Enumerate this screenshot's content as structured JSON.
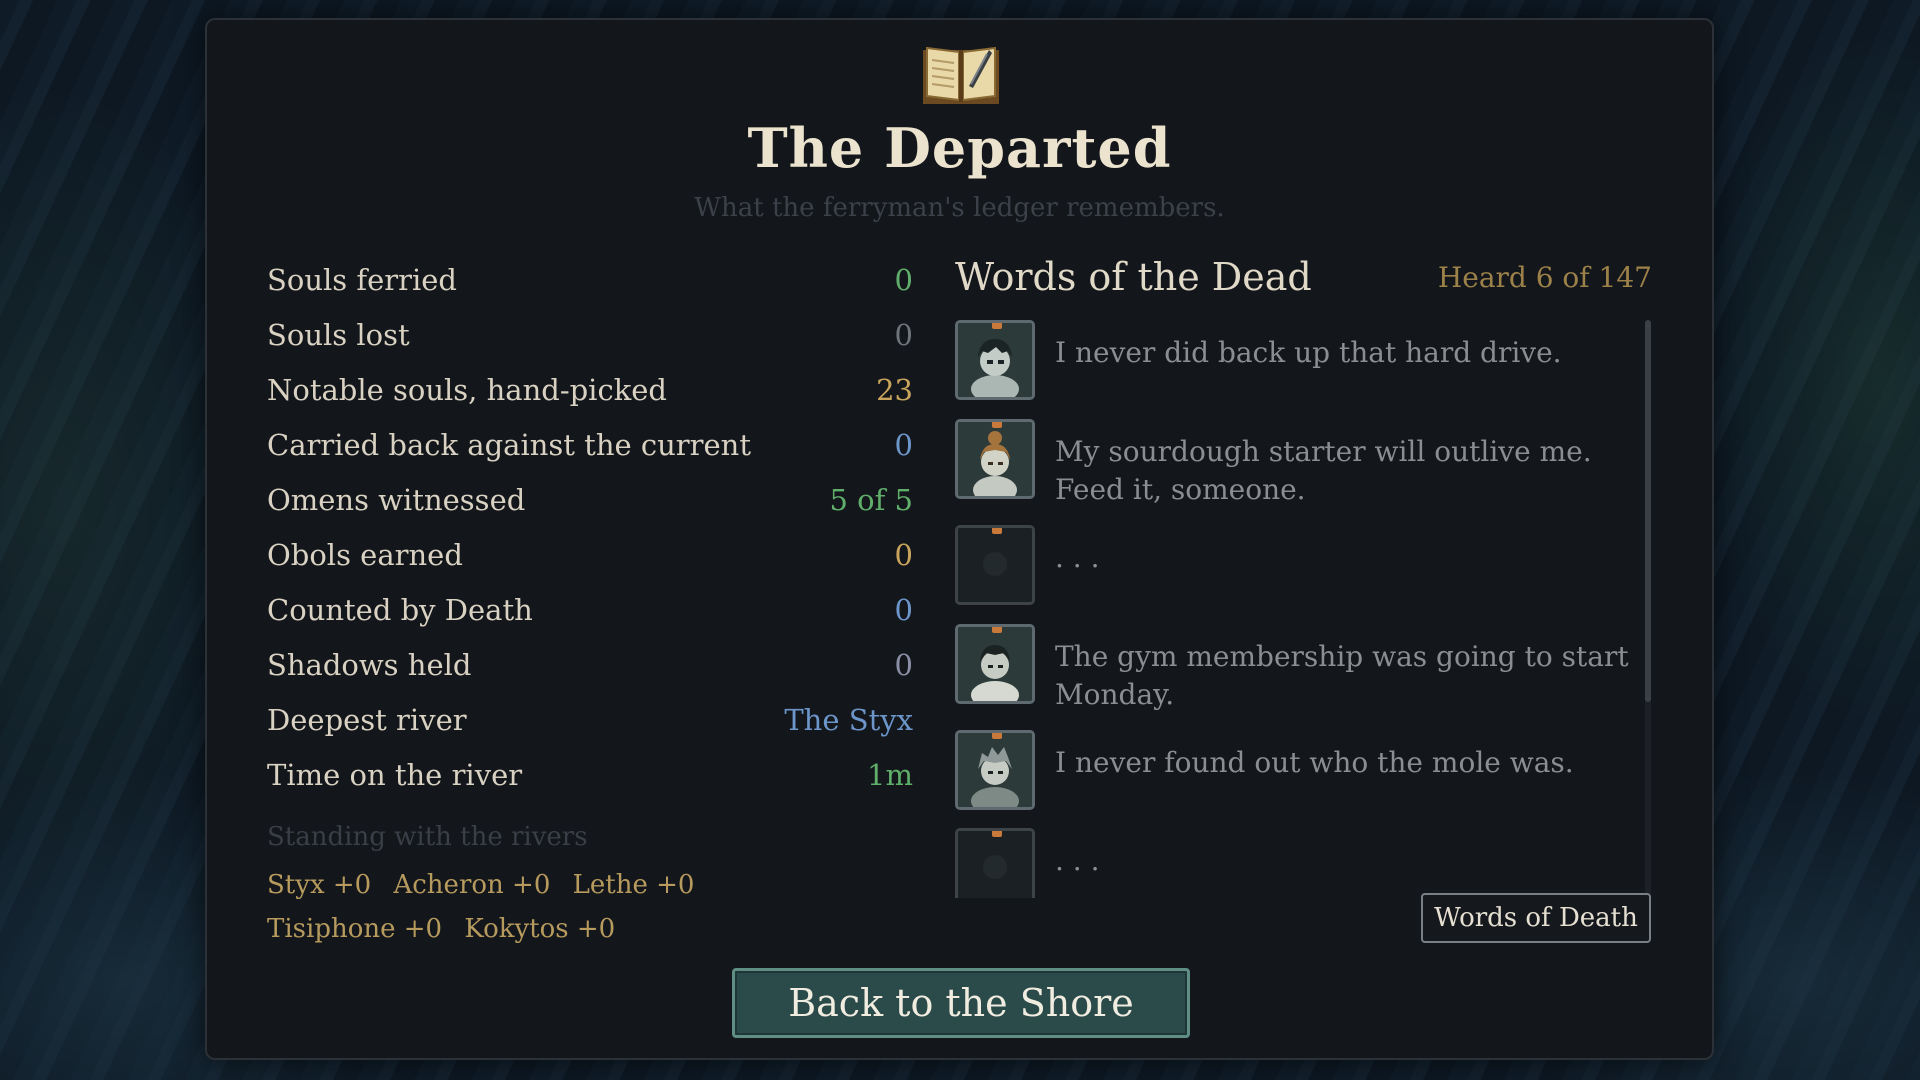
{
  "header": {
    "icon": "open-book-quill-icon",
    "title": "The Departed",
    "subtitle": "What the ferryman's ledger remembers."
  },
  "stats": [
    {
      "label": "Souls ferried",
      "value": "0",
      "color": "#5fae6a"
    },
    {
      "label": "Souls lost",
      "value": "0",
      "color": "#6f737a"
    },
    {
      "label": "Notable souls, hand-picked",
      "value": "23",
      "color": "#c9a45c"
    },
    {
      "label": "Carried back against the current",
      "value": "0",
      "color": "#6c95c9"
    },
    {
      "label": "Omens witnessed",
      "value": "5 of 5",
      "color": "#5fae6a"
    },
    {
      "label": "Obols earned",
      "value": "0",
      "color": "#c9a45c"
    },
    {
      "label": "Counted by Death",
      "value": "0",
      "color": "#6c95c9"
    },
    {
      "label": "Shadows held",
      "value": "0",
      "color": "#8a8fa6"
    },
    {
      "label": "Deepest river",
      "value": "The Styx",
      "color": "#6c95c9"
    },
    {
      "label": "Time on the river",
      "value": "1m",
      "color": "#5fae6a"
    }
  ],
  "standing": {
    "title": "Standing with the rivers",
    "rivers": [
      "Styx +0",
      "Acheron +0",
      "Lethe +0",
      "Tisiphone +0",
      "Kokytos +0"
    ]
  },
  "words": {
    "title": "Words of the Dead",
    "count": "Heard 6 of 147",
    "entries": [
      {
        "quote": "I never did back up that hard drive.",
        "portrait": "dark-haired-soul-portrait"
      },
      {
        "quote": "My sourdough starter will outlive me. Feed it, someone.",
        "portrait": "bun-haired-soul-portrait"
      },
      {
        "quote": ". . .",
        "portrait": "unknown-soul-portrait"
      },
      {
        "quote": "The gym membership was going to start Monday.",
        "portrait": "short-haired-soul-portrait"
      },
      {
        "quote": "I never found out who the mole was.",
        "portrait": "messy-haired-soul-portrait"
      },
      {
        "quote": ". . .",
        "portrait": "unknown-soul-portrait"
      }
    ]
  },
  "buttons": {
    "words_of_death": "Words of Death",
    "back": "Back to the Shore"
  }
}
